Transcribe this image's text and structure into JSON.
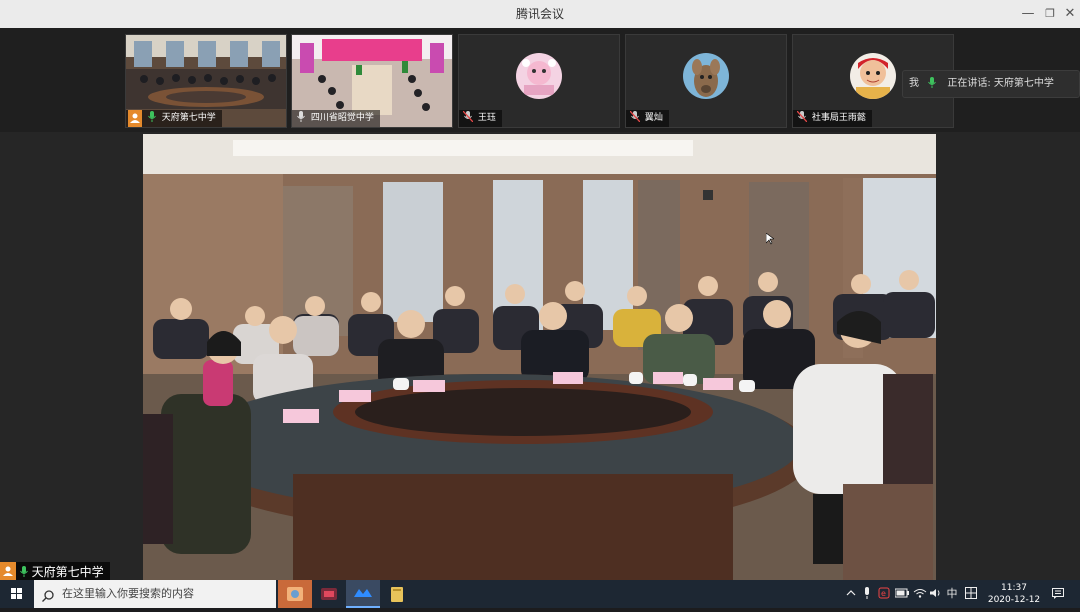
{
  "window": {
    "title": "腾讯会议",
    "minimize_glyph": "—",
    "restore_glyph": "❐",
    "close_glyph": "✕"
  },
  "participants": [
    {
      "name": "天府第七中学",
      "icon": "user-icon",
      "mic": "mic-on-icon"
    },
    {
      "name": "四川省昭觉中学",
      "icon": "",
      "mic": "mic-on-icon"
    },
    {
      "name": "王珏",
      "icon": "",
      "mic": "mic-off-icon"
    },
    {
      "name": "翼灿",
      "icon": "",
      "mic": "mic-off-icon"
    },
    {
      "name": "社事局王雨懿",
      "icon": "",
      "mic": "mic-off-icon"
    }
  ],
  "speaking": {
    "me_label": "我",
    "text": "正在讲话: 天府第七中学"
  },
  "local_video": {
    "name": "天府第七中学"
  },
  "taskbar": {
    "search_placeholder": "在这里输入你要搜索的内容",
    "ime": "中",
    "time": "11:37",
    "date": "2020-12-12"
  },
  "colors": {
    "titlebar": "#ebebeb",
    "strip": "#1f1f1f",
    "taskbar": "#1d2733",
    "accent_orange": "#e58a2c",
    "mic_green": "#3ec25e"
  }
}
